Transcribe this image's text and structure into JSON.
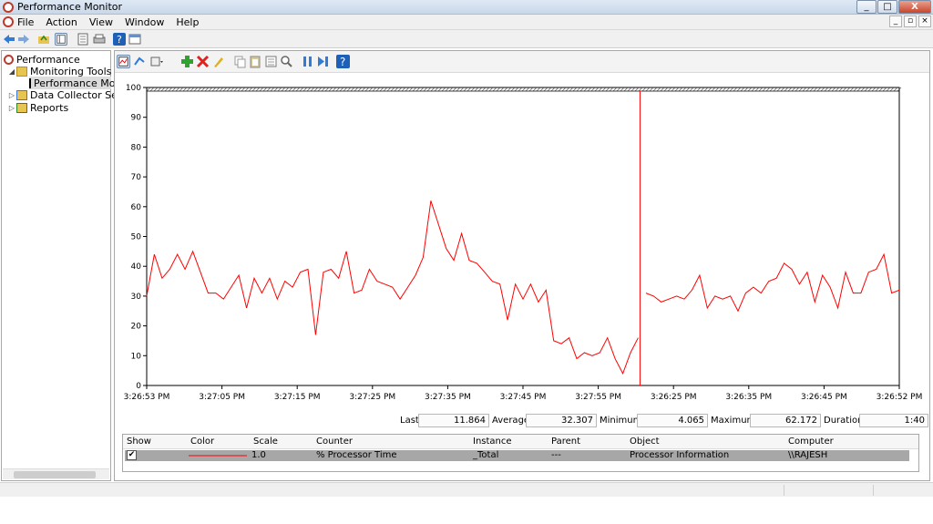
{
  "window": {
    "title": "Performance Monitor",
    "min": "_",
    "max": "□",
    "close": "X"
  },
  "menu": {
    "items": [
      "File",
      "Action",
      "View",
      "Window",
      "Help"
    ]
  },
  "tree": {
    "root": "Performance",
    "monitoring": "Monitoring Tools",
    "perfmon": "Performance Mon",
    "dcs": "Data Collector Sets",
    "reports": "Reports"
  },
  "icons": [
    "back-icon",
    "forward-icon",
    "folder-up-icon",
    "console-tree-icon",
    "properties-icon",
    "print-icon",
    "help-icon",
    "mmc-icon"
  ],
  "chart_data": {
    "type": "line",
    "series": [
      {
        "name": "% Processor Time",
        "color": "#ff0000",
        "values": [
          30,
          44,
          36,
          39,
          44,
          39,
          45,
          38,
          31,
          31,
          29,
          33,
          37,
          26,
          36,
          31,
          36,
          29,
          35,
          33,
          38,
          39,
          17,
          38,
          39,
          36,
          45,
          31,
          32,
          39,
          35,
          34,
          33,
          29,
          33,
          37,
          43,
          62,
          54,
          46,
          42,
          51,
          42,
          41,
          38,
          35,
          34,
          22,
          34,
          29,
          34,
          28,
          32,
          15,
          14,
          16,
          9,
          11,
          10,
          11,
          16,
          9,
          4,
          11,
          16,
          31,
          30,
          28,
          29,
          30,
          29,
          32,
          37,
          26,
          30,
          29,
          30,
          25,
          31,
          33,
          31,
          35,
          36,
          41,
          39,
          34,
          38,
          28,
          37,
          33,
          26,
          38,
          31,
          31,
          38,
          39,
          44,
          31,
          32
        ],
        "gap_after_index": 64
      }
    ],
    "ylim": [
      0,
      100
    ],
    "yticks": [
      0,
      10,
      20,
      30,
      40,
      50,
      60,
      70,
      80,
      90,
      100
    ],
    "xticks": [
      "3:26:53 PM",
      "3:27:05 PM",
      "3:27:15 PM",
      "3:27:25 PM",
      "3:27:35 PM",
      "3:27:45 PM",
      "3:27:55 PM",
      "3:26:25 PM",
      "3:26:35 PM",
      "3:26:45 PM",
      "3:26:52 PM"
    ],
    "cursor_index": 64
  },
  "stats": {
    "last_label": "Last",
    "last": "11.864",
    "avg_label": "Average",
    "avg": "32.307",
    "min_label": "Minimum",
    "min": "4.065",
    "max_label": "Maximum",
    "max": "62.172",
    "dur_label": "Duration",
    "dur": "1:40"
  },
  "legend": {
    "headers": {
      "show": "Show",
      "color": "Color",
      "scale": "Scale",
      "counter": "Counter",
      "instance": "Instance",
      "parent": "Parent",
      "object": "Object",
      "computer": "Computer"
    },
    "row": {
      "checked": "✔",
      "line_color": "#ff0000",
      "scale": "1.0",
      "counter": "% Processor Time",
      "instance": "_Total",
      "parent": "---",
      "object": "Processor Information",
      "computer": "\\\\RAJESH"
    }
  }
}
